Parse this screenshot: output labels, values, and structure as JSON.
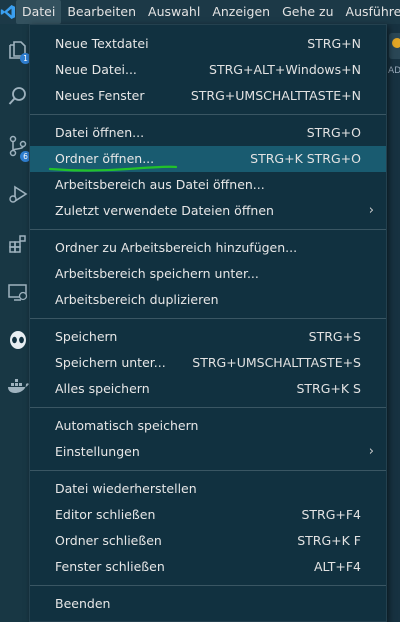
{
  "menubar": {
    "items": [
      "Datei",
      "Bearbeiten",
      "Auswahl",
      "Anzeigen",
      "Gehe zu",
      "Ausführen"
    ]
  },
  "activity": {
    "explorer_badge": "1",
    "scm_badge": "6"
  },
  "editor_peek": {
    "text": "AD"
  },
  "menu": {
    "groups": [
      [
        {
          "label": "Neue Textdatei",
          "shortcut": "STRG+N"
        },
        {
          "label": "Neue Datei...",
          "shortcut": "STRG+ALT+Windows+N"
        },
        {
          "label": "Neues Fenster",
          "shortcut": "STRG+UMSCHALTTASTE+N"
        }
      ],
      [
        {
          "label": "Datei öffnen...",
          "shortcut": "STRG+O"
        },
        {
          "label": "Ordner öffnen...",
          "shortcut": "STRG+K STRG+O"
        },
        {
          "label": "Arbeitsbereich aus Datei öffnen...",
          "shortcut": ""
        },
        {
          "label": "Zuletzt verwendete Dateien öffnen",
          "shortcut": ""
        }
      ],
      [
        {
          "label": "Ordner zu Arbeitsbereich hinzufügen...",
          "shortcut": ""
        },
        {
          "label": "Arbeitsbereich speichern unter...",
          "shortcut": ""
        },
        {
          "label": "Arbeitsbereich duplizieren",
          "shortcut": ""
        }
      ],
      [
        {
          "label": "Speichern",
          "shortcut": "STRG+S"
        },
        {
          "label": "Speichern unter...",
          "shortcut": "STRG+UMSCHALTTASTE+S"
        },
        {
          "label": "Alles speichern",
          "shortcut": "STRG+K S"
        }
      ],
      [
        {
          "label": "Automatisch speichern",
          "shortcut": ""
        },
        {
          "label": "Einstellungen",
          "shortcut": ""
        }
      ],
      [
        {
          "label": "Datei wiederherstellen",
          "shortcut": ""
        },
        {
          "label": "Editor schließen",
          "shortcut": "STRG+F4"
        },
        {
          "label": "Ordner schließen",
          "shortcut": "STRG+K F"
        },
        {
          "label": "Fenster schließen",
          "shortcut": "ALT+F4"
        }
      ],
      [
        {
          "label": "Beenden",
          "shortcut": ""
        }
      ]
    ]
  },
  "colors": {
    "menu_bg": "#113140",
    "highlight": "#195b70",
    "annotation": "#22c22a"
  }
}
